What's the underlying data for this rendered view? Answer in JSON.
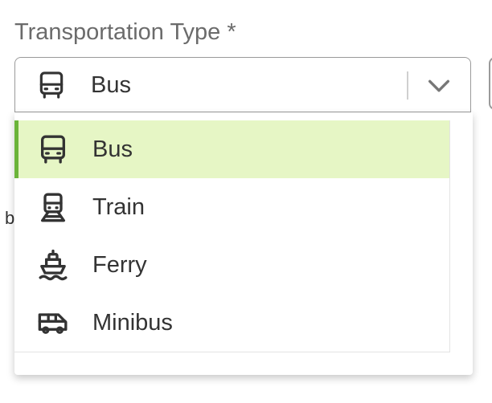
{
  "field": {
    "label": "Transportation Type *",
    "selected_value": "Bus",
    "selected_icon": "bus-icon"
  },
  "background": {
    "stray_text": "b"
  },
  "options": [
    {
      "label": "Bus",
      "icon": "bus-icon",
      "selected": true
    },
    {
      "label": "Train",
      "icon": "train-icon",
      "selected": false
    },
    {
      "label": "Ferry",
      "icon": "ferry-icon",
      "selected": false
    },
    {
      "label": "Minibus",
      "icon": "minibus-icon",
      "selected": false
    }
  ],
  "colors": {
    "selected_background": "#e6f6c5",
    "selected_accent": "#6bb43a",
    "text": "#333333",
    "label_text": "#6b6b6b"
  }
}
